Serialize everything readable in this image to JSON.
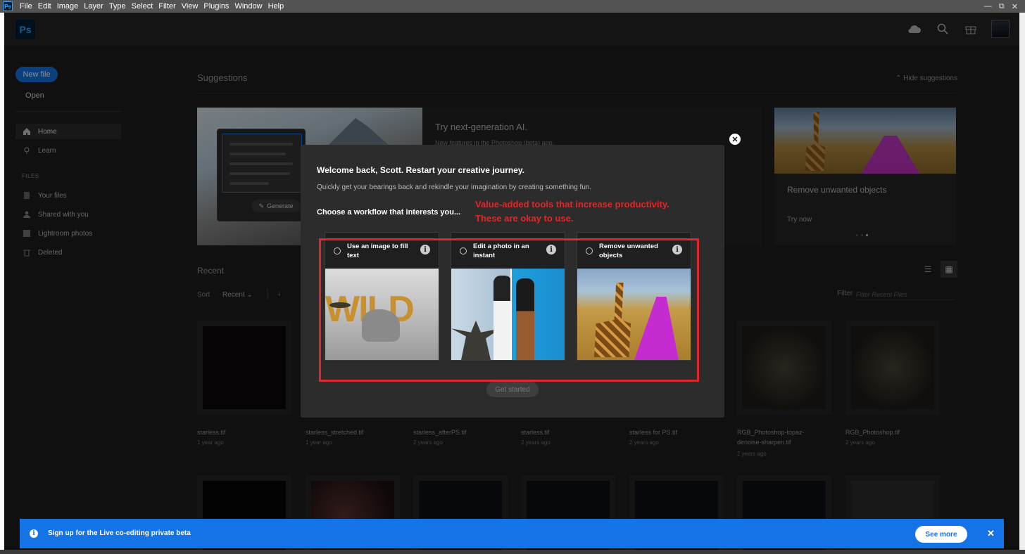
{
  "menubar": {
    "items": [
      "File",
      "Edit",
      "Image",
      "Layer",
      "Type",
      "Select",
      "Filter",
      "View",
      "Plugins",
      "Window",
      "Help"
    ],
    "window_controls": [
      "—",
      "⧉",
      "✕"
    ]
  },
  "app": {
    "icon_label": "Ps"
  },
  "sidebar": {
    "new_file": "New file",
    "open": "Open",
    "items": [
      {
        "label": "Home",
        "icon": "home-icon"
      },
      {
        "label": "Learn",
        "icon": "lightbulb-icon"
      }
    ],
    "files_heading": "FILES",
    "file_items": [
      {
        "label": "Your files",
        "icon": "file-icon"
      },
      {
        "label": "Shared with you",
        "icon": "people-icon"
      },
      {
        "label": "Lightroom photos",
        "icon": "lightroom-icon"
      },
      {
        "label": "Deleted",
        "icon": "trash-icon"
      }
    ]
  },
  "suggestions": {
    "title": "Suggestions",
    "hide": "Hide suggestions",
    "card1": {
      "title": "Try next-generation AI.",
      "subtitle": "New features in the Photoshop (beta) app.",
      "generate": "Generate"
    },
    "card2": {
      "title": "Remove unwanted objects",
      "action": "Try now"
    }
  },
  "recent": {
    "title": "Recent",
    "sort_label": "Sort",
    "sort_value": "Recent",
    "filter_label": "Filter",
    "filter_placeholder": "Filter Recent Files",
    "files": [
      {
        "name": "starless.tif",
        "age": "1 year ago"
      },
      {
        "name": "starless_stretched.tif",
        "age": "1 year ago"
      },
      {
        "name": "starless_afterPS.tif",
        "age": "2 years ago"
      },
      {
        "name": "starless.tif",
        "age": "2 years ago"
      },
      {
        "name": "starless for PS.tif",
        "age": "2 years ago"
      },
      {
        "name": "RGB_Photoshop-topaz-denoise-sharpen.tif",
        "age": "2 years ago"
      },
      {
        "name": "RGB_Photoshop.tif",
        "age": "2 years ago"
      }
    ]
  },
  "modal": {
    "title": "Welcome back, Scott. Restart your creative journey.",
    "subtitle": "Quickly get your bearings back and rekindle your imagination by creating something fun.",
    "choose": "Choose a workflow that interests you...",
    "annotation_line1": "Value-added tools that increase productivity.",
    "annotation_line2": "These are okay to use.",
    "workflows": [
      {
        "label": "Use an image to fill text"
      },
      {
        "label": "Edit a photo in an instant"
      },
      {
        "label": "Remove unwanted objects"
      }
    ],
    "get_started": "Get started",
    "image_text": "WILD"
  },
  "banner": {
    "text": "Sign up for the Live co-editing private beta",
    "see_more": "See more"
  },
  "colors": {
    "accent": "#1473e6",
    "annotation_red": "#e0282a",
    "background": "#1e1e1e"
  }
}
